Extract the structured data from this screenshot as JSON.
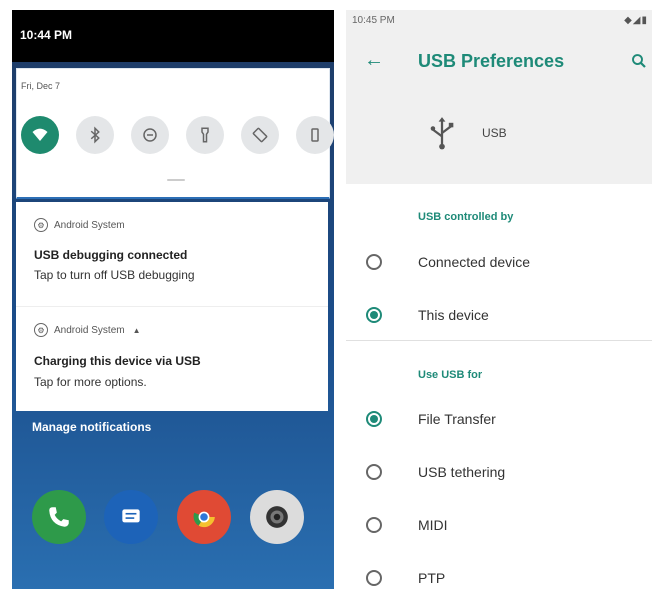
{
  "left": {
    "time": "10:44 PM",
    "date": "Fri, Dec 7",
    "quick_tiles": [
      {
        "icon": "wifi-icon",
        "active": true
      },
      {
        "icon": "bluetooth-icon",
        "active": false
      },
      {
        "icon": "do-not-disturb-icon",
        "active": false
      },
      {
        "icon": "flashlight-icon",
        "active": false
      },
      {
        "icon": "auto-rotate-icon",
        "active": false
      },
      {
        "icon": "battery-saver-icon",
        "active": false
      }
    ],
    "notifications": [
      {
        "app": "Android System",
        "title": "USB debugging connected",
        "text": "Tap to turn off USB debugging"
      },
      {
        "app": "Android System",
        "title": "Charging this device via USB",
        "text": "Tap for more options."
      }
    ],
    "manage_label": "Manage notifications",
    "dock": [
      "phone-icon",
      "messages-icon",
      "chrome-icon",
      "camera-icon"
    ],
    "accent": "#1e8a6e"
  },
  "right": {
    "time": "10:45 PM",
    "title": "USB Preferences",
    "usb_label": "USB",
    "section_controlled": "USB controlled by",
    "controlled_options": [
      {
        "label": "Connected device",
        "selected": false
      },
      {
        "label": "This device",
        "selected": true
      }
    ],
    "section_use": "Use USB for",
    "use_options": [
      {
        "label": "File Transfer",
        "selected": true
      },
      {
        "label": "USB tethering",
        "selected": false
      },
      {
        "label": "MIDI",
        "selected": false
      },
      {
        "label": "PTP",
        "selected": false
      }
    ],
    "accent": "#1e8a78"
  }
}
